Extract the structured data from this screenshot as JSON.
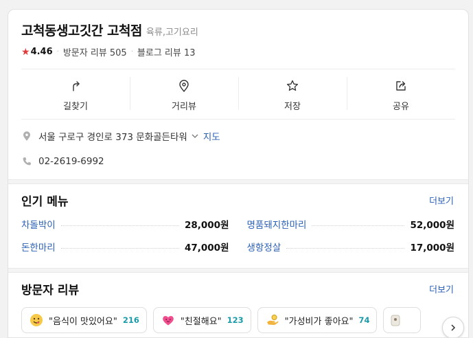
{
  "place": {
    "name": "고척동생고깃간 고척점",
    "category": "육류,고기요리",
    "rating": "4.46",
    "visitor_reviews": "방문자 리뷰 505",
    "blog_reviews": "블로그 리뷰 13",
    "star_color": "#e03c3c"
  },
  "actions": [
    {
      "label": "길찾기",
      "icon": "directions-icon"
    },
    {
      "label": "거리뷰",
      "icon": "location-pin-icon"
    },
    {
      "label": "저장",
      "icon": "star-outline-icon"
    },
    {
      "label": "공유",
      "icon": "share-icon"
    }
  ],
  "info": {
    "address": "서울 구로구 경인로 373 문화골든타워",
    "map_link": "지도",
    "phone": "02-2619-6992"
  },
  "popular_menu": {
    "title": "인기 메뉴",
    "more": "더보기",
    "items": [
      {
        "name": "차돌박이",
        "price": "28,000원"
      },
      {
        "name": "명품돼지한마리",
        "price": "52,000원"
      },
      {
        "name": "돈한마리",
        "price": "47,000원"
      },
      {
        "name": "생항정살",
        "price": "17,000원"
      }
    ]
  },
  "visitor_review": {
    "title": "방문자 리뷰",
    "more": "더보기",
    "keywords": [
      {
        "text": "\"음식이 맛있어요\"",
        "count": "216",
        "icon": "yum-face-icon"
      },
      {
        "text": "\"친절해요\"",
        "count": "123",
        "icon": "heart-icon"
      },
      {
        "text": "\"가성비가 좋아요\"",
        "count": "74",
        "icon": "coin-hand-icon"
      }
    ]
  },
  "colors": {
    "link": "#2a5fb5",
    "count": "#1b9aa8"
  }
}
